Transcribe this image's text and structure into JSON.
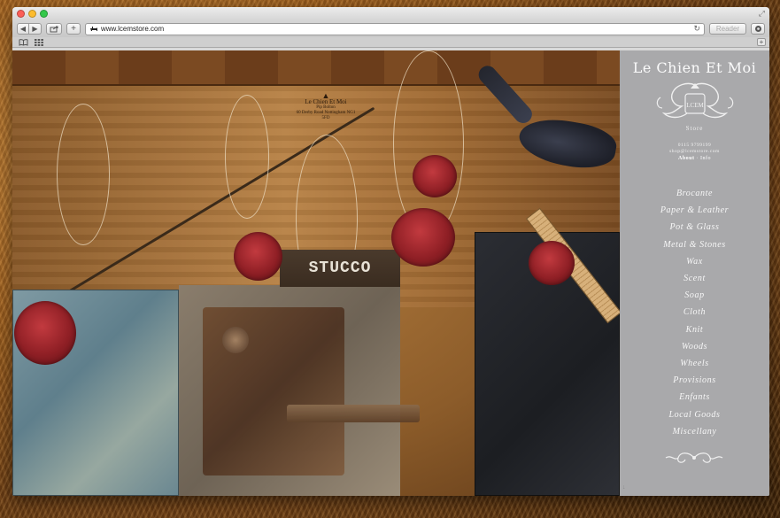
{
  "browser": {
    "address": {
      "url": "www.lcemstore.com"
    },
    "buttons": {
      "back": "◀",
      "forward": "▶",
      "add": "+",
      "reader": "Reader",
      "reload": "↻"
    },
    "window_controls": {
      "fullscreen": "⤢"
    },
    "icons": {
      "share": "share-icon",
      "bookmarks_book": "book-icon",
      "top_sites": "grid-icon",
      "settings": "gear-icon",
      "site": "dog-icon"
    }
  },
  "photo": {
    "card": {
      "title": "Le Chien Et Moi",
      "line2": "Pip Bolton",
      "line3": "60 Derby Road Nottingham NG1 5FD"
    },
    "stucco_text": "STUCCO"
  },
  "sidebar": {
    "brand": "Le Chien Et Moi",
    "crest_label": "LCEM",
    "subtitle": "Store",
    "contact": {
      "phone": "0115 9799199",
      "email": "shop@lcemstore.com"
    },
    "about_label": "About",
    "separator": "·",
    "info_label": "Info",
    "menu": [
      "Brocante",
      "Paper & Leather",
      "Pot & Glass",
      "Metal & Stones",
      "Wax",
      "Scent",
      "Soap",
      "Cloth",
      "Knit",
      "Woods",
      "Wheels",
      "Provisions",
      "Enfants",
      "Local Goods",
      "Miscellany"
    ],
    "scroll_hint": "↓"
  },
  "colors": {
    "sidebar_bg": "#a9a9ab",
    "sidebar_text": "#f7f7f7"
  }
}
